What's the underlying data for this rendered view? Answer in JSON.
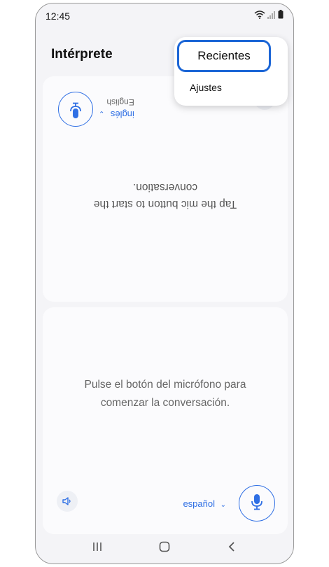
{
  "status_bar": {
    "time": "12:45"
  },
  "app": {
    "title": "Intérprete"
  },
  "top_panel": {
    "language": "inglés",
    "language_sub": "English",
    "prompt": "Tap the mic button to start the conversation."
  },
  "bottom_panel": {
    "prompt": "Pulse el botón del micrófono para comenzar la conversación.",
    "language": "español"
  },
  "menu": {
    "items": [
      {
        "label": "Recientes"
      },
      {
        "label": "Ajustes"
      }
    ]
  },
  "colors": {
    "accent": "#2f6fe4",
    "highlight": "#1c66d6"
  },
  "icons": [
    "wifi-icon",
    "signal-icon",
    "battery-icon",
    "microphone-icon",
    "speaker-icon",
    "chevron-down-icon",
    "recents-nav-icon",
    "home-nav-icon",
    "back-nav-icon"
  ]
}
